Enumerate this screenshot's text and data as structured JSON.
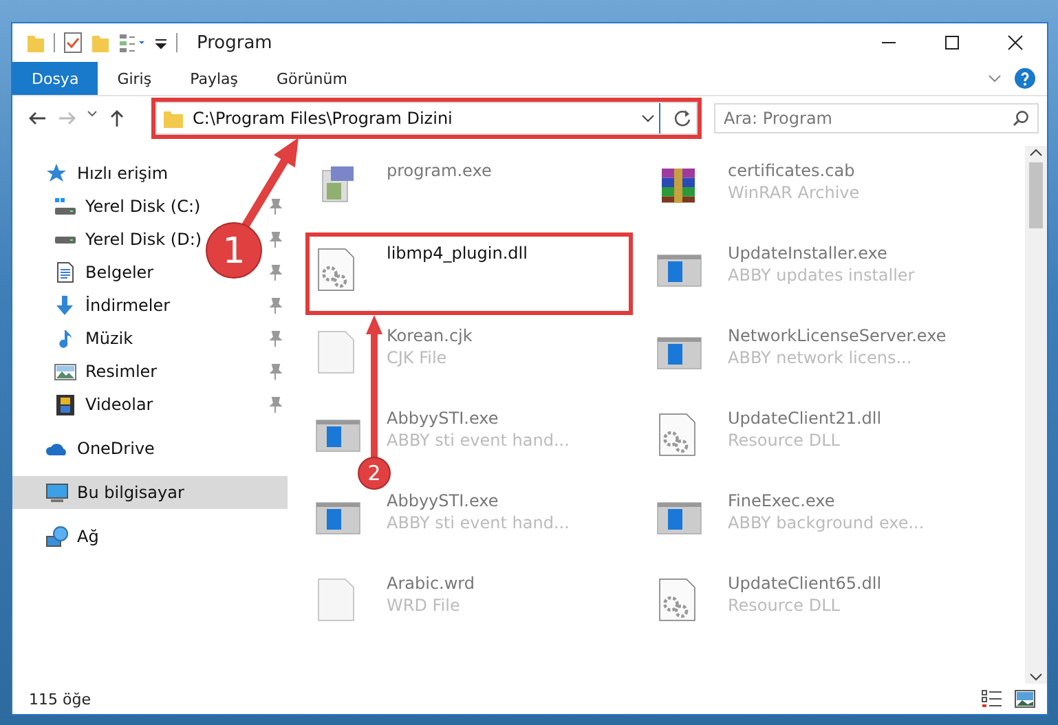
{
  "window": {
    "title": "Program"
  },
  "ribbon_tabs": [
    {
      "label": "Dosya",
      "selected": true
    },
    {
      "label": "Giriş",
      "selected": false
    },
    {
      "label": "Paylaş",
      "selected": false
    },
    {
      "label": "Görünüm",
      "selected": false
    }
  ],
  "address": {
    "path": "C:\\Program Files\\Program Dizini",
    "marked": true
  },
  "search": {
    "placeholder": "Ara: Program"
  },
  "sidebar": {
    "items": [
      {
        "label": "Hızlı erişim",
        "kind": "star",
        "selected": false,
        "children": [
          {
            "label": "Yerel Disk (C:)",
            "kind": "system-drive",
            "pinned": true,
            "selected": false
          },
          {
            "label": "Yerel Disk (D:)",
            "kind": "drive",
            "pinned": true,
            "selected": false
          },
          {
            "label": "Belgeler",
            "kind": "documents",
            "pinned": true,
            "selected": false
          },
          {
            "label": "İndirmeler",
            "kind": "downloads",
            "pinned": true,
            "selected": false
          },
          {
            "label": "Müzik",
            "kind": "music",
            "pinned": true,
            "selected": false
          },
          {
            "label": "Resimler",
            "kind": "pictures",
            "pinned": true,
            "selected": false
          },
          {
            "label": "Videolar",
            "kind": "videos",
            "pinned": true,
            "selected": false
          }
        ]
      },
      {
        "label": "OneDrive",
        "kind": "cloud",
        "selected": false
      },
      {
        "label": "Bu bilgisayar",
        "kind": "computer",
        "selected": true
      },
      {
        "label": "Ağ",
        "kind": "network",
        "selected": false
      }
    ]
  },
  "files": [
    {
      "name": "program.exe",
      "kind": "setup",
      "marked": false
    },
    {
      "name": "certificates.cab",
      "type": "WinRAR Archive",
      "kind": "archive",
      "marked": false
    },
    {
      "name": "libmp4_plugin.dll",
      "kind": "dll",
      "marked": true
    },
    {
      "name": "UpdateInstaller.exe",
      "type": "ABBY updates installer",
      "kind": "app",
      "marked": false
    },
    {
      "name": "Korean.cjk",
      "type": "CJK File",
      "kind": "blank",
      "marked": false
    },
    {
      "name": "NetworkLicenseServer.exe",
      "type": "ABBY network licens...",
      "kind": "app",
      "marked": false
    },
    {
      "name": "AbbyySTI.exe",
      "type": "ABBY sti event hand...",
      "kind": "app",
      "marked": false
    },
    {
      "name": "UpdateClient21.dll",
      "type": "Resource DLL",
      "kind": "dll",
      "marked": false
    },
    {
      "name": "AbbyySTI.exe",
      "type": "ABBY sti event hand...",
      "kind": "app",
      "marked": false
    },
    {
      "name": "FineExec.exe",
      "type": "ABBY background exe...",
      "kind": "app",
      "marked": false
    },
    {
      "name": "Arabic.wrd",
      "type": "WRD File",
      "kind": "blank",
      "marked": false
    },
    {
      "name": "UpdateClient65.dll",
      "type": "Resource DLL",
      "kind": "dll",
      "marked": false
    }
  ],
  "status_bar": {
    "count": "115 öğe"
  },
  "steps": [
    {
      "number": "1",
      "kind": "address"
    },
    {
      "number": "2",
      "kind": "file"
    }
  ]
}
